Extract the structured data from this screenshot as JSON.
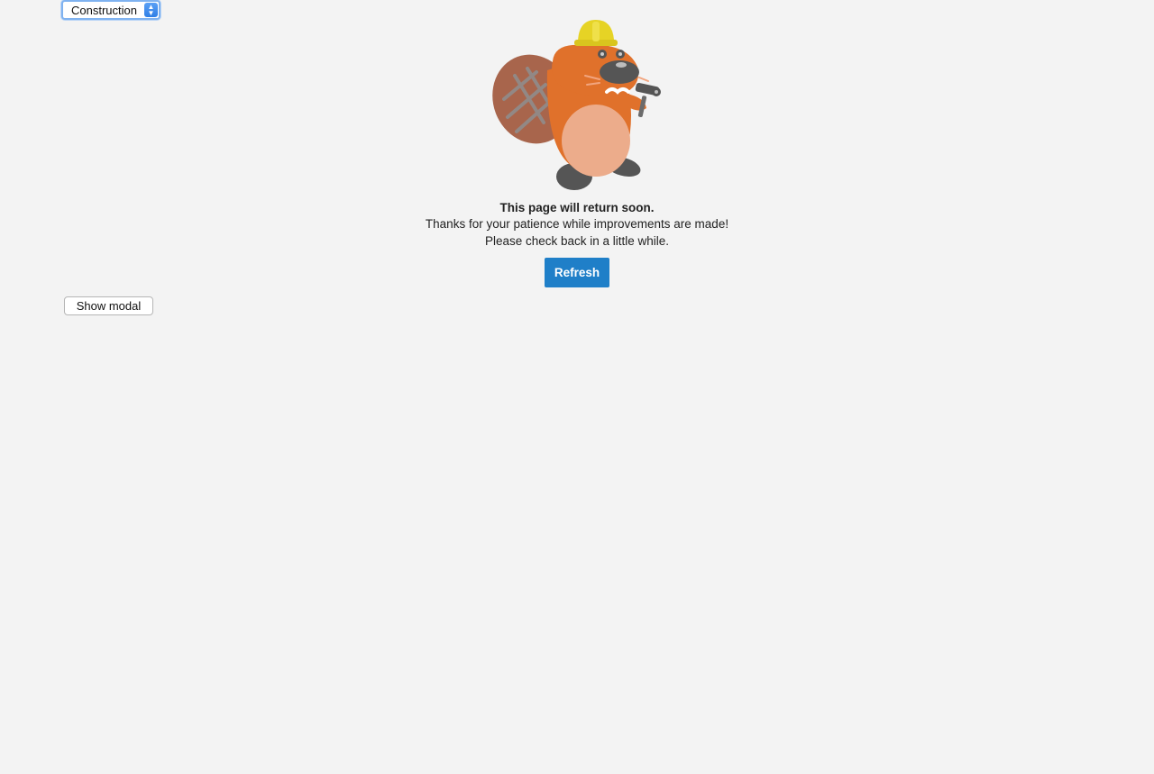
{
  "state_select": {
    "selected": "Construction"
  },
  "illustration": {
    "name": "beaver-construction-mascot",
    "colors": {
      "fur": "#e0712b",
      "belly": "#ecac8b",
      "tail": "#a8654c",
      "hardhat": "#e6d325",
      "dark": "#555555"
    }
  },
  "message": {
    "title": "This page will return soon.",
    "line1": "Thanks for your patience while improvements are made!",
    "line2": "Please check back in a little while."
  },
  "buttons": {
    "refresh": "Refresh",
    "show_modal": "Show modal"
  },
  "colors": {
    "background": "#f3f3f3",
    "accent": "#1f7fc8"
  }
}
